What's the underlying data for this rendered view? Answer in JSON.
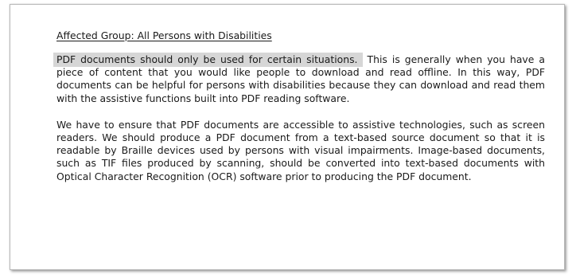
{
  "document": {
    "group_line": "Affected Group: All Persons with Disabilities",
    "para1_highlight": "PDF documents should only be used for certain situations.",
    "para1_rest": " This is generally when you have a piece of content that you would like people to download and read offline. In this way, PDF documents can be helpful for persons with disabilities because they can download and read them with the assistive functions built into PDF reading software.",
    "para2": "We have to ensure that PDF documents are accessible to assistive technologies, such as screen readers. We should produce a PDF document from a text-based source document so that it is readable by Braille devices used by persons with visual impairments. Image-based documents, such as TIF files produced by scanning, should be converted into text-based documents with Optical Character Recognition (OCR) software prior to producing the PDF document."
  },
  "colors": {
    "highlight": "#d6d6d6",
    "text": "#1a1a1a",
    "border": "#b9b9b9"
  }
}
